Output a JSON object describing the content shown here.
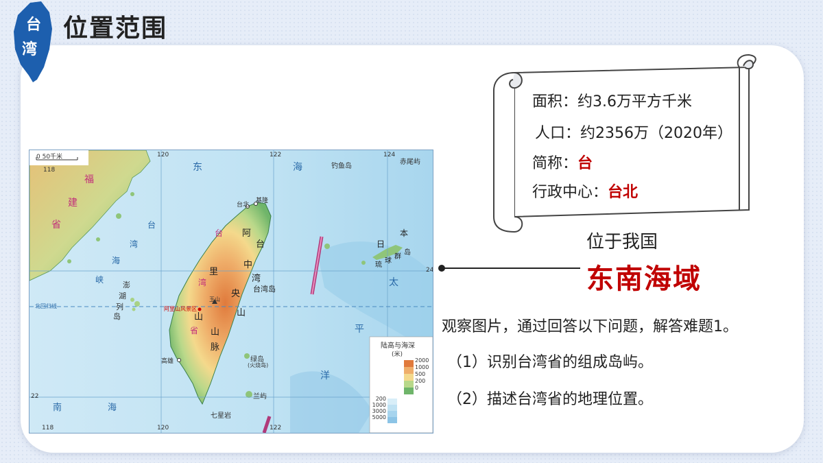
{
  "badge": {
    "line1": "台",
    "line2": "湾"
  },
  "title": "位置范围",
  "info": {
    "area_label": "面积：",
    "area_value": "约3.6万平方千米",
    "pop_label": "人口：",
    "pop_value": "约2356万（2020年）",
    "abbr_label": "简称：",
    "abbr_value": "台",
    "capital_label": "行政中心：",
    "capital_value": "台北"
  },
  "location": {
    "intro": "位于我国",
    "main": "东南海域"
  },
  "questions": {
    "prompt": "观察图片，通过回答以下问题，解答难题1。",
    "q1": "（1）识别台湾省的组成岛屿。",
    "q2": "（2）描述台湾省的地理位置。"
  },
  "map": {
    "scale": "0    50千米",
    "lon_118": "118",
    "lon_120": "120",
    "lon_122": "122",
    "lon_124": "124",
    "lat_24": "24",
    "lat_22": "22",
    "tropic": "北回归线",
    "sea_east": "东",
    "sea_hai": "海",
    "diaoyu": "钓鱼岛",
    "chiwei": "赤尾屿",
    "fu": "福",
    "jian": "建",
    "sheng": "省",
    "strait_1": "台",
    "strait_2": "湾",
    "strait_3": "海",
    "strait_4": "峡",
    "penghu_1": "澎",
    "penghu_2": "湖",
    "penghu_3": "列",
    "penghu_4": "岛",
    "taipei": "台北",
    "keelung": "基隆",
    "ali_1": "阿",
    "ali_2": "里",
    "ali_3": "山",
    "ali_4": "山",
    "ali_5": "脉",
    "zhong_1": "中",
    "zhong_2": "央",
    "tai_1": "台",
    "wan_1": "湾",
    "taiwan_island": "台湾岛",
    "yushan": "玉山",
    "alishan_area": "阿里山风景区",
    "ryukyu_1": "日",
    "ryukyu_2": "本",
    "ryukyu_3": "琉",
    "ryukyu_4": "球",
    "ryukyu_5": "群",
    "ryukyu_6": "岛",
    "tai_ocean": "太",
    "ping": "平",
    "yang": "洋",
    "south_1": "南",
    "south_2": "海",
    "green_island": "绿岛",
    "green_island_sub": "(火烧岛)",
    "lanyu": "兰屿",
    "qixingyan": "七星岩",
    "kaohsiung": "高雄",
    "legend_title": "陆高与海深",
    "legend_unit": "(米)",
    "legend_values": [
      "2000",
      "1000",
      "500",
      "200",
      "0"
    ],
    "legend_depths": [
      "200",
      "1000",
      "3000",
      "5000"
    ]
  }
}
